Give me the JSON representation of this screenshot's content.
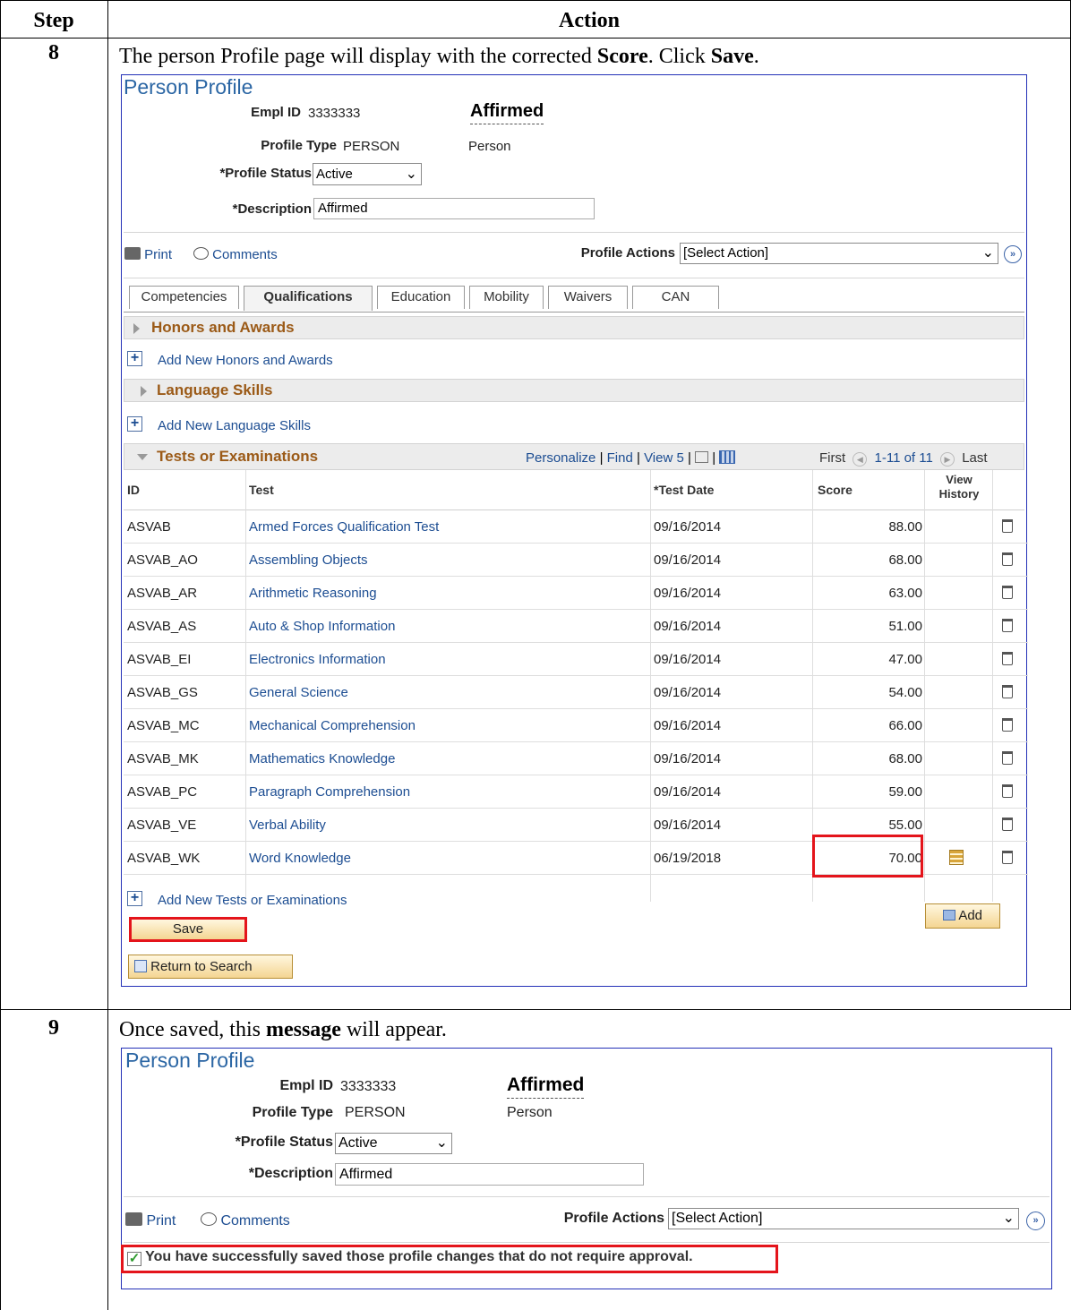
{
  "table_header": {
    "step": "Step",
    "action": "Action"
  },
  "step8": {
    "number": "8",
    "instruction_pre": "The person Profile page will display with the corrected ",
    "instruction_b1": "Score",
    "instruction_mid": ". Click ",
    "instruction_b2": "Save",
    "instruction_end": "."
  },
  "step9": {
    "number": "9",
    "instruction_pre": "Once saved, this ",
    "instruction_b1": "message",
    "instruction_end": " will appear."
  },
  "profile": {
    "title": "Person Profile",
    "empl_id_label": "Empl ID",
    "empl_id": "3333333",
    "status_title": "Affirmed",
    "profile_type_label": "Profile Type",
    "profile_type": "PERSON",
    "profile_type_desc": "Person",
    "profile_status_label": "*Profile Status",
    "profile_status": "Active",
    "description_label": "*Description",
    "description": "Affirmed",
    "print": "Print",
    "comments": "Comments",
    "actions_label": "Profile Actions",
    "actions_value": "[Select Action]"
  },
  "tabs": [
    "Competencies",
    "Qualifications",
    "Education",
    "Mobility",
    "Waivers",
    "CAN"
  ],
  "sections": {
    "honors": "Honors and Awards",
    "add_honors": "Add New Honors and Awards",
    "language": "Language Skills",
    "add_language": "Add New Language Skills",
    "tests": "Tests or Examinations",
    "add_tests": "Add New Tests or Examinations"
  },
  "grid_nav": {
    "personalize": "Personalize",
    "find": "Find",
    "view": "View 5",
    "first": "First",
    "range": "1-11 of 11",
    "last": "Last",
    "sep": "|"
  },
  "grid_headers": {
    "id": "ID",
    "test": "Test",
    "date": "*Test Date",
    "score": "Score",
    "history_1": "View",
    "history_2": "History"
  },
  "tests": [
    {
      "id": "ASVAB",
      "test": "Armed Forces Qualification Test",
      "date": "09/16/2014",
      "score": "88.00"
    },
    {
      "id": "ASVAB_AO",
      "test": "Assembling Objects",
      "date": "09/16/2014",
      "score": "68.00"
    },
    {
      "id": "ASVAB_AR",
      "test": "Arithmetic Reasoning",
      "date": "09/16/2014",
      "score": "63.00"
    },
    {
      "id": "ASVAB_AS",
      "test": "Auto & Shop Information",
      "date": "09/16/2014",
      "score": "51.00"
    },
    {
      "id": "ASVAB_EI",
      "test": "Electronics Information",
      "date": "09/16/2014",
      "score": "47.00"
    },
    {
      "id": "ASVAB_GS",
      "test": "General Science",
      "date": "09/16/2014",
      "score": "54.00"
    },
    {
      "id": "ASVAB_MC",
      "test": "Mechanical Comprehension",
      "date": "09/16/2014",
      "score": "66.00"
    },
    {
      "id": "ASVAB_MK",
      "test": "Mathematics Knowledge",
      "date": "09/16/2014",
      "score": "68.00"
    },
    {
      "id": "ASVAB_PC",
      "test": "Paragraph Comprehension",
      "date": "09/16/2014",
      "score": "59.00"
    },
    {
      "id": "ASVAB_VE",
      "test": "Verbal Ability",
      "date": "09/16/2014",
      "score": "55.00"
    },
    {
      "id": "ASVAB_WK",
      "test": "Word Knowledge",
      "date": "06/19/2018",
      "score": "70.00"
    }
  ],
  "buttons": {
    "add": "Add",
    "save": "Save",
    "return": "Return to Search"
  },
  "success_message": "You have successfully saved those profile changes that do not require approval.",
  "colors": {
    "highlight": "#e4141b",
    "section_title": "#9b5a17",
    "link": "#1c4d92",
    "panel_border": "#2431b7",
    "title": "#2b66a4"
  }
}
